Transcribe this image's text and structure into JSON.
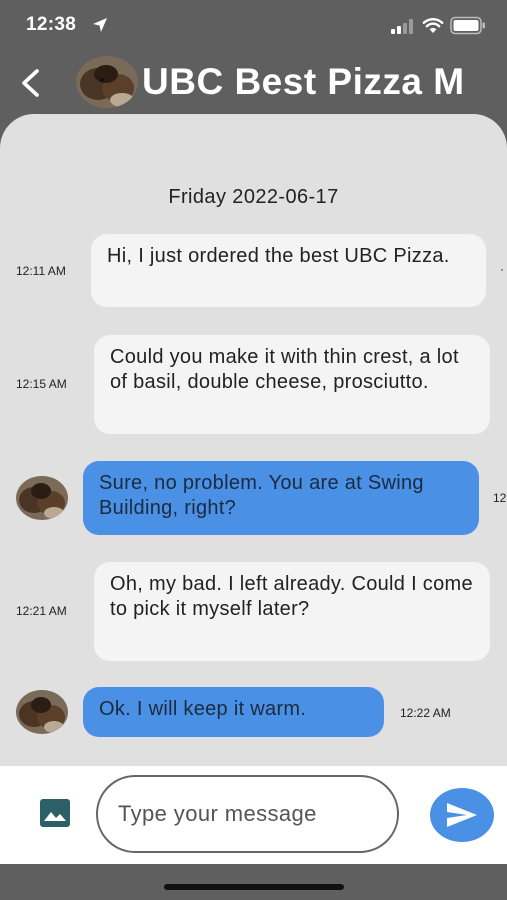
{
  "status_bar": {
    "time": "12:38",
    "icons": [
      "location-arrow-icon",
      "signal-icon",
      "wifi-icon",
      "battery-icon"
    ]
  },
  "header": {
    "title": "UBC Best Pizza M",
    "back_icon": "chevron-left-icon",
    "avatar": "dog-avatar"
  },
  "chat": {
    "date": "Friday 2022-06-17",
    "messages": [
      {
        "side": "received",
        "time": "12:11 AM",
        "text": "Hi, I just ordered the best UBC Pizza."
      },
      {
        "side": "received",
        "time": "12:15 AM",
        "text": "Could you make it with thin crest, a lot of basil, double cheese, prosciutto."
      },
      {
        "side": "sent",
        "time": "12",
        "text": "Sure, no problem. You are at Swing Building, right?"
      },
      {
        "side": "received",
        "time": "12:21 AM",
        "text": "Oh, my bad. I left already. Could I come to pick it myself later?"
      },
      {
        "side": "sent",
        "time": "12:22 AM",
        "text": "Ok. I will keep it warm."
      }
    ]
  },
  "input": {
    "placeholder": "Type your message",
    "value": "",
    "image_icon": "image-icon",
    "send_icon": "send-icon"
  },
  "colors": {
    "background_dark": "#5f5f5f",
    "chat_background": "#e0e0e0",
    "received_bubble": "#f4f4f4",
    "sent_bubble": "#4a91e6",
    "accent": "#4a91e6",
    "image_icon": "#2d5f66"
  }
}
